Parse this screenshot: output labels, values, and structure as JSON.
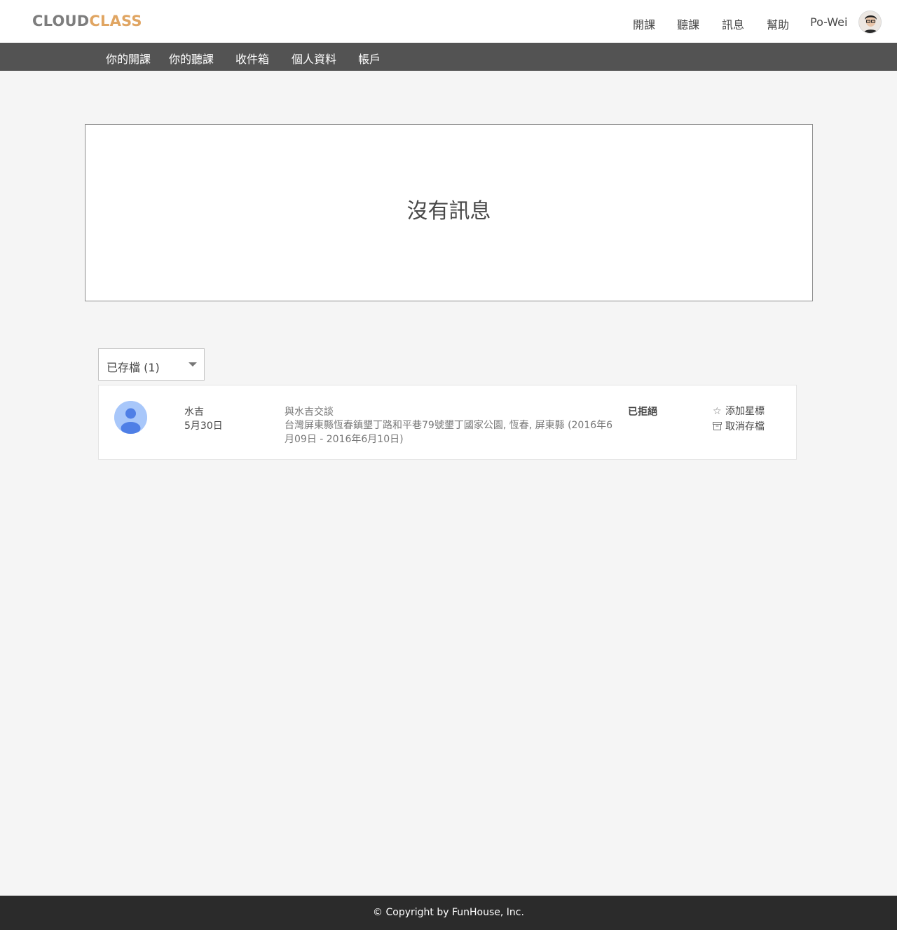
{
  "brand": {
    "part1": "CLOUD",
    "part2": "CLASS"
  },
  "topnav": {
    "host": "開課",
    "learn": "聽課",
    "messages": "訊息",
    "help": "幫助",
    "user": "Po-Wei"
  },
  "subnav": {
    "items": [
      "你的開課",
      "你的聽課",
      "收件箱",
      "個人資料",
      "帳戶"
    ]
  },
  "empty_state": {
    "message": "沒有訊息"
  },
  "filter": {
    "selected": "已存檔 (1)"
  },
  "thread": {
    "name": "水吉",
    "date": "5月30日",
    "subject": "與水吉交談",
    "detail": "台灣屏東縣恆春鎮墾丁路和平巷79號墾丁國家公園, 恆春, 屏東縣 (2016年6月09日 - 2016年6月10日)",
    "status": "已拒絕",
    "star_label": "添加星標",
    "unarchive_label": "取消存檔"
  },
  "footer": {
    "copyright": "© Copyright by FunHouse, Inc."
  },
  "colors": {
    "brand_gray": "#7d7d7d",
    "brand_orange": "#e0a562",
    "subnav_bg": "#535353",
    "footer_bg": "#2b2b2b",
    "avatar_blue": "#a8c7fa"
  },
  "icons": {
    "star": "star-outline-icon",
    "archive": "archive-icon",
    "dropdown": "caret-down-icon"
  }
}
